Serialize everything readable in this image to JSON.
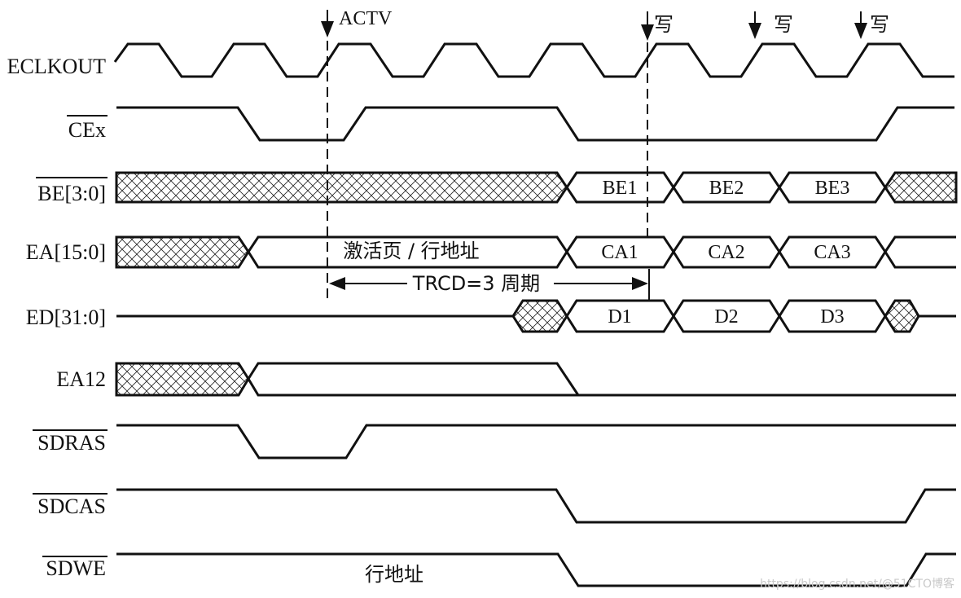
{
  "diagram": {
    "type": "SDRAM write timing diagram",
    "signals": [
      {
        "id": "eclkout",
        "label": "ECLKOUT",
        "overbar": false
      },
      {
        "id": "cex",
        "label": "CEx",
        "overbar": true
      },
      {
        "id": "be",
        "label": "BE[3:0]",
        "overbar": true
      },
      {
        "id": "ea",
        "label": "EA[15:0]",
        "overbar": false
      },
      {
        "id": "ed",
        "label": "ED[31:0]",
        "overbar": false
      },
      {
        "id": "ea12",
        "label": "EA12",
        "overbar": false
      },
      {
        "id": "sdras",
        "label": "SDRAS",
        "overbar": true
      },
      {
        "id": "sdcas",
        "label": "SDCAS",
        "overbar": true
      },
      {
        "id": "sdwe",
        "label": "SDWE",
        "overbar": true
      }
    ],
    "buses": {
      "be": [
        "BE1",
        "BE2",
        "BE3"
      ],
      "ea_row": "激活页 / 行地址",
      "ea": [
        "CA1",
        "CA2",
        "CA3"
      ],
      "ed": [
        "D1",
        "D2",
        "D3"
      ]
    },
    "markers": {
      "actv": "ACTV",
      "write": [
        "写",
        "写",
        "写"
      ]
    },
    "trcd_label": "TRCD=3 周期",
    "sdwe_note": "行地址",
    "watermark": "https://blog.csdn.net/@51CTO博客",
    "colors": {
      "line": "#111111",
      "background": "#ffffff",
      "watermark": "#c9c9c9"
    }
  }
}
